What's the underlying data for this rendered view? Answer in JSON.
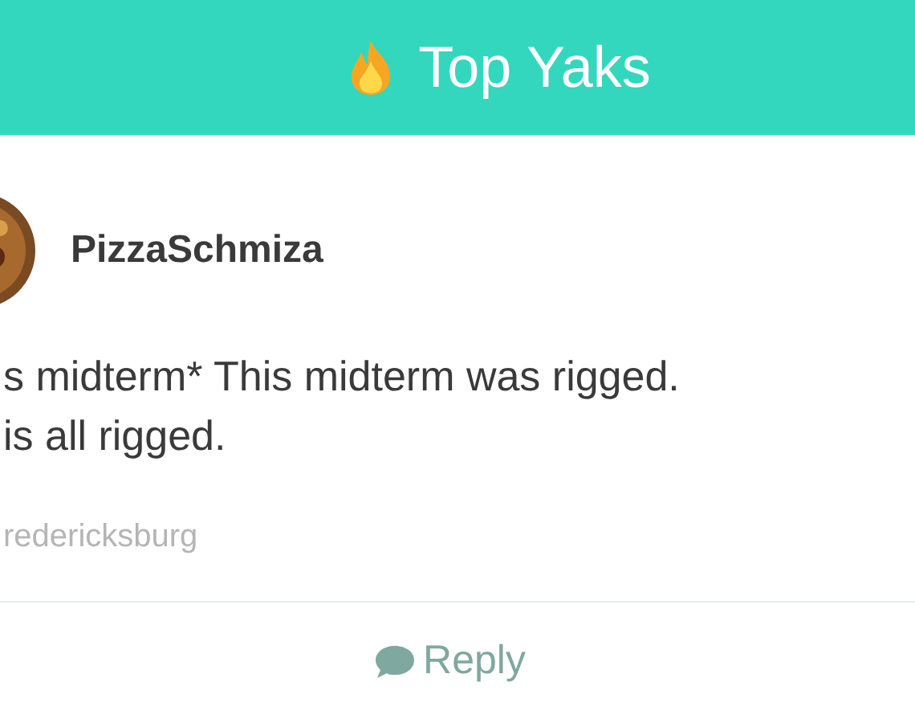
{
  "header": {
    "title": "Top Yaks"
  },
  "post": {
    "username": "PizzaSchmiza",
    "text_lines": [
      "s midterm* This midterm was rigged.",
      "is all rigged."
    ],
    "location": "redericksburg"
  },
  "actions": {
    "reply": "Reply"
  }
}
